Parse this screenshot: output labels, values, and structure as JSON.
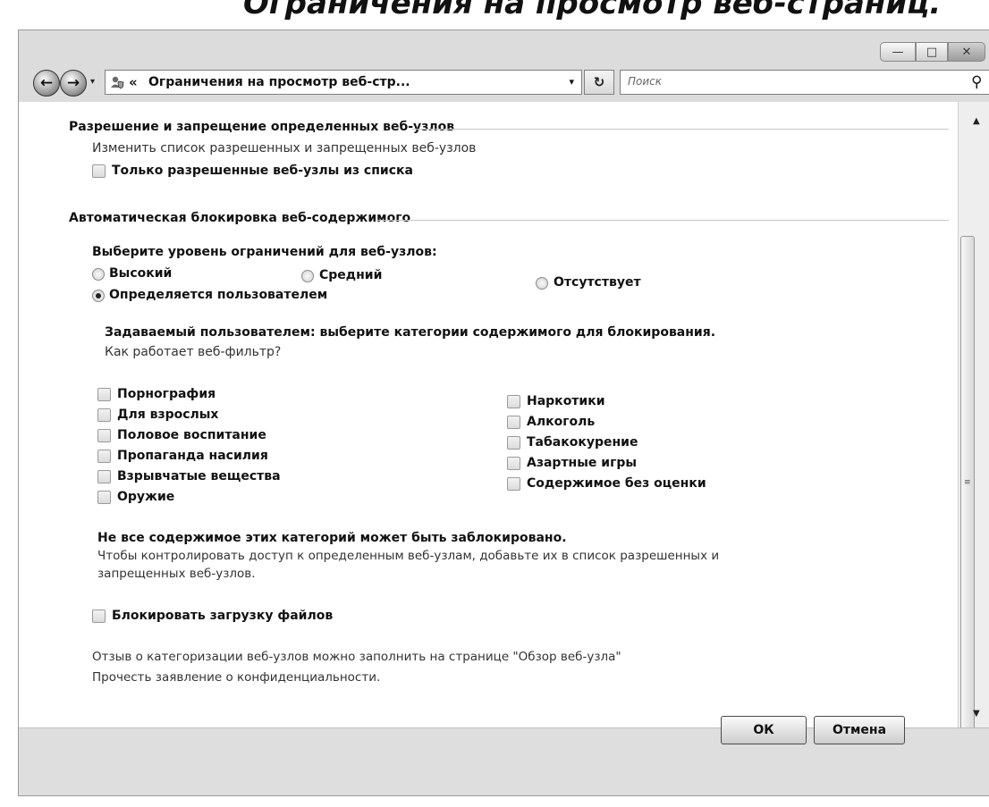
{
  "page_heading": "Ограничения на просмотр веб-страниц.",
  "window": {
    "minimize_glyph": "—",
    "maximize_glyph": "□",
    "close_glyph": "✕"
  },
  "toolbar": {
    "back_glyph": "←",
    "forward_glyph": "→",
    "address_icon": "shield-user-icon",
    "address_chevron": "«",
    "address_text": "Ограничения на просмотр веб-стр...",
    "dropdown_glyph": "▾",
    "refresh_glyph": "↻",
    "search_placeholder": "Поиск",
    "search_icon_glyph": "⚲"
  },
  "section_allow_block": {
    "header": "Разрешение и запрещение определенных веб-узлов",
    "edit_list_link": "Изменить список разрешенных и запрещенных веб-узлов",
    "only_allowed_label": "Только разрешенные веб-узлы из списка",
    "only_allowed_checked": false
  },
  "section_auto_block": {
    "header": "Автоматическая блокировка веб-содержимого",
    "level_prompt": "Выберите уровень ограничений для веб-узлов:",
    "levels": [
      {
        "label": "Высокий",
        "selected": false
      },
      {
        "label": "Средний",
        "selected": false
      },
      {
        "label": "Отсутствует",
        "selected": false
      },
      {
        "label": "Определяется пользователем",
        "selected": true
      }
    ],
    "custom_intro": "Задаваемый пользователем:  выберите категории содержимого для блокирования.",
    "how_filter_works_link": "Как работает веб-фильтр?",
    "categories_left": [
      {
        "label": "Порнография",
        "checked": false
      },
      {
        "label": "Для взрослых",
        "checked": false
      },
      {
        "label": "Половое воспитание",
        "checked": false
      },
      {
        "label": "Пропаганда насилия",
        "checked": false
      },
      {
        "label": "Взрывчатые вещества",
        "checked": false
      },
      {
        "label": "Оружие",
        "checked": false
      }
    ],
    "categories_right": [
      {
        "label": "Наркотики",
        "checked": false
      },
      {
        "label": "Алкоголь",
        "checked": false
      },
      {
        "label": "Табакокурение",
        "checked": false
      },
      {
        "label": "Азартные игры",
        "checked": false
      },
      {
        "label": "Содержимое без оценки",
        "checked": false
      }
    ],
    "not_all_blocked_note": "Не все содержимое этих категорий может быть заблокировано.",
    "control_access_line1": "Чтобы контролировать доступ к определенным веб-узлам, добавьте их в список разрешенных и",
    "control_access_line2": "запрещенных веб-узлов.",
    "block_downloads_label": "Блокировать загрузку файлов",
    "block_downloads_checked": false
  },
  "footer_links": {
    "feedback_text": "Отзыв о категоризации веб-узлов можно заполнить на странице \"Обзор веб-узла\"",
    "privacy_text": "Прочесть заявление о конфиденциальности."
  },
  "buttons": {
    "ok": "ОК",
    "cancel": "Отмена"
  },
  "scrollbar": {
    "up_glyph": "▲",
    "down_glyph": "▼",
    "grip_glyph": "≡"
  }
}
